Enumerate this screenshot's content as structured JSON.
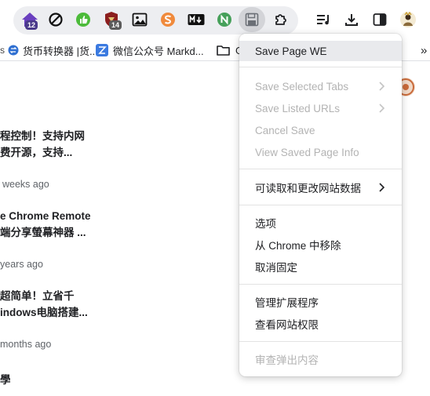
{
  "toolbar": {
    "badges": {
      "ext_home": "12",
      "ext_shield": "14"
    }
  },
  "bookmarks": [
    {
      "label": "货币转换器 |货..."
    },
    {
      "label": "微信公众号 Markd..."
    },
    {
      "label": "G"
    }
  ],
  "bookmarks_overflow": "»",
  "feed": [
    {
      "title1": "程控制！支持内网",
      "title2": "费开源，支持...",
      "time": "weeks ago"
    },
    {
      "title1": "e Chrome Remote",
      "title2": "端分享螢幕神器 ...",
      "time": "years ago"
    },
    {
      "title1": "超简单！立省千",
      "title2": "indows电脑搭建...",
      "time": "months ago"
    },
    {
      "title1": "學",
      "title2": "",
      "time": ""
    }
  ],
  "menu": {
    "title": "Save Page WE",
    "group1": [
      "Save Selected Tabs",
      "Save Listed URLs",
      "Cancel Save",
      "View Saved Page Info"
    ],
    "site_data": "可读取和更改网站数据",
    "group3": [
      "选项",
      "从 Chrome 中移除",
      "取消固定"
    ],
    "group4": [
      "管理扩展程序",
      "查看网站权限"
    ],
    "inspect": "审查弹出内容"
  },
  "colors": {
    "pill": "#edeef1",
    "highlight": "#e9eaed",
    "disabled": "#b3b3b3"
  }
}
